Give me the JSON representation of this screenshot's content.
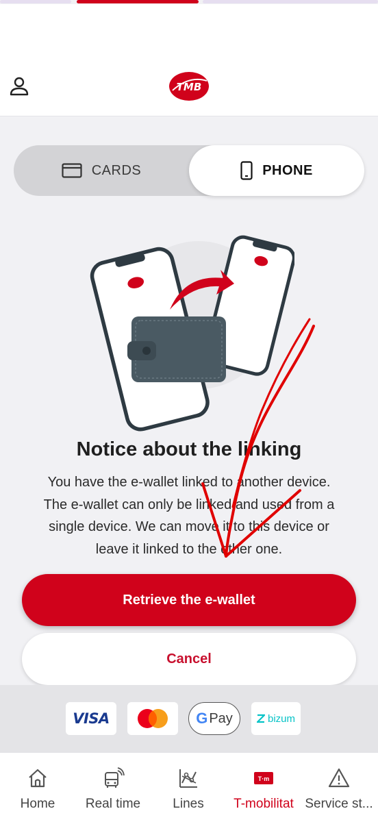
{
  "header": {
    "logo_text": "TMB"
  },
  "toggle": {
    "cards_label": "CARDS",
    "phone_label": "PHONE",
    "selected": "PHONE"
  },
  "notice": {
    "title": "Notice about the linking",
    "line1": "You have the e-wallet linked to another device.",
    "line2": "The e-wallet can only be linked and used from a",
    "line3": "single device. We can move it to this device or",
    "line4": "leave it linked to the other one."
  },
  "actions": {
    "primary_label": "Retrieve the e-wallet",
    "secondary_label": "Cancel"
  },
  "payments": {
    "visa": "VISA",
    "gpay": "Pay",
    "gpay_g": "G",
    "bizum": "bizum"
  },
  "nav": {
    "items": [
      {
        "label": "Home",
        "icon": "home-icon"
      },
      {
        "label": "Real time",
        "icon": "bus-realtime-icon"
      },
      {
        "label": "Lines",
        "icon": "lines-icon"
      },
      {
        "label": "T-mobilitat",
        "icon": "t-mobilitat-icon",
        "active": true
      },
      {
        "label": "Service st...",
        "icon": "warning-icon"
      }
    ],
    "tm_badge": "T·m"
  },
  "colors": {
    "brand_red": "#d0021b",
    "wallet": "#4a5a63",
    "background": "#f1f1f4"
  }
}
